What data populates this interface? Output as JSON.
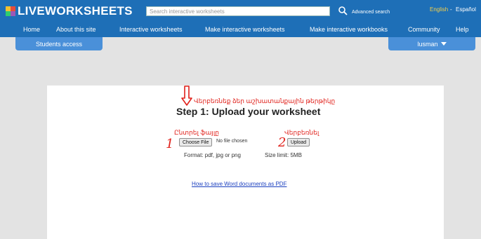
{
  "header": {
    "logo_text": "LIVEWORKSHEETS",
    "search_placeholder": "Search interactive worksheets",
    "advanced_search": "Advanced search",
    "lang_english": "English",
    "lang_sep": "-",
    "lang_espanol": "Español"
  },
  "nav": {
    "items": [
      "Home",
      "About this site",
      "Interactive worksheets",
      "Make interactive worksheets",
      "Make interactive workbooks",
      "Community",
      "Help"
    ]
  },
  "tabs": {
    "students": "Students access",
    "user": "lusman"
  },
  "upload": {
    "annotation_top": "Վերբեռնեք ձեր աշխատանքային թերթիկը",
    "title": "Step 1: Upload your worksheet",
    "annotation_choose": "Ընտրել ֆայլը",
    "annotation_upload": "Վերբեռնել",
    "choose_file": "Choose File",
    "no_file": "No file chosen",
    "upload_button": "Upload",
    "format": "Format: pdf, jpg or png",
    "size_limit": "Size limit: 5MB",
    "handwritten_1": "1",
    "handwritten_2": "2",
    "pdf_link": "How to save Word documents as PDF"
  },
  "colors": {
    "header_blue": "#1e6fb7",
    "tab_blue": "#4a90d9",
    "annotation_red": "#e0201a",
    "lang_active": "#f5d04a"
  },
  "icons": [
    "logo-grid-icon",
    "search-icon",
    "chevron-down-icon",
    "down-arrow-icon"
  ]
}
